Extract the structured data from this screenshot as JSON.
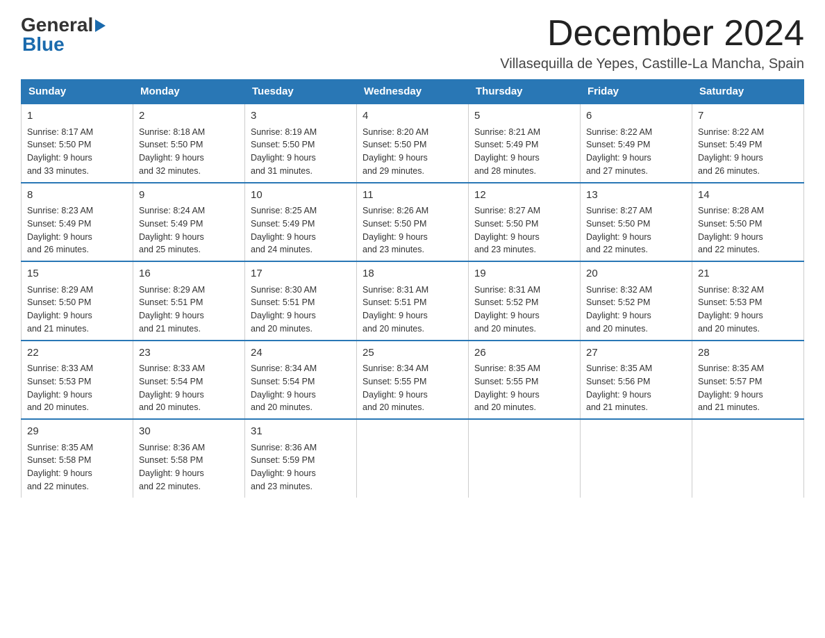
{
  "header": {
    "title": "December 2024",
    "subtitle": "Villasequilla de Yepes, Castille-La Mancha, Spain",
    "logo_general": "General",
    "logo_blue": "Blue"
  },
  "weekdays": [
    "Sunday",
    "Monday",
    "Tuesday",
    "Wednesday",
    "Thursday",
    "Friday",
    "Saturday"
  ],
  "weeks": [
    [
      {
        "day": "1",
        "sunrise": "8:17 AM",
        "sunset": "5:50 PM",
        "daylight": "9 hours and 33 minutes."
      },
      {
        "day": "2",
        "sunrise": "8:18 AM",
        "sunset": "5:50 PM",
        "daylight": "9 hours and 32 minutes."
      },
      {
        "day": "3",
        "sunrise": "8:19 AM",
        "sunset": "5:50 PM",
        "daylight": "9 hours and 31 minutes."
      },
      {
        "day": "4",
        "sunrise": "8:20 AM",
        "sunset": "5:50 PM",
        "daylight": "9 hours and 29 minutes."
      },
      {
        "day": "5",
        "sunrise": "8:21 AM",
        "sunset": "5:49 PM",
        "daylight": "9 hours and 28 minutes."
      },
      {
        "day": "6",
        "sunrise": "8:22 AM",
        "sunset": "5:49 PM",
        "daylight": "9 hours and 27 minutes."
      },
      {
        "day": "7",
        "sunrise": "8:22 AM",
        "sunset": "5:49 PM",
        "daylight": "9 hours and 26 minutes."
      }
    ],
    [
      {
        "day": "8",
        "sunrise": "8:23 AM",
        "sunset": "5:49 PM",
        "daylight": "9 hours and 26 minutes."
      },
      {
        "day": "9",
        "sunrise": "8:24 AM",
        "sunset": "5:49 PM",
        "daylight": "9 hours and 25 minutes."
      },
      {
        "day": "10",
        "sunrise": "8:25 AM",
        "sunset": "5:49 PM",
        "daylight": "9 hours and 24 minutes."
      },
      {
        "day": "11",
        "sunrise": "8:26 AM",
        "sunset": "5:50 PM",
        "daylight": "9 hours and 23 minutes."
      },
      {
        "day": "12",
        "sunrise": "8:27 AM",
        "sunset": "5:50 PM",
        "daylight": "9 hours and 23 minutes."
      },
      {
        "day": "13",
        "sunrise": "8:27 AM",
        "sunset": "5:50 PM",
        "daylight": "9 hours and 22 minutes."
      },
      {
        "day": "14",
        "sunrise": "8:28 AM",
        "sunset": "5:50 PM",
        "daylight": "9 hours and 22 minutes."
      }
    ],
    [
      {
        "day": "15",
        "sunrise": "8:29 AM",
        "sunset": "5:50 PM",
        "daylight": "9 hours and 21 minutes."
      },
      {
        "day": "16",
        "sunrise": "8:29 AM",
        "sunset": "5:51 PM",
        "daylight": "9 hours and 21 minutes."
      },
      {
        "day": "17",
        "sunrise": "8:30 AM",
        "sunset": "5:51 PM",
        "daylight": "9 hours and 20 minutes."
      },
      {
        "day": "18",
        "sunrise": "8:31 AM",
        "sunset": "5:51 PM",
        "daylight": "9 hours and 20 minutes."
      },
      {
        "day": "19",
        "sunrise": "8:31 AM",
        "sunset": "5:52 PM",
        "daylight": "9 hours and 20 minutes."
      },
      {
        "day": "20",
        "sunrise": "8:32 AM",
        "sunset": "5:52 PM",
        "daylight": "9 hours and 20 minutes."
      },
      {
        "day": "21",
        "sunrise": "8:32 AM",
        "sunset": "5:53 PM",
        "daylight": "9 hours and 20 minutes."
      }
    ],
    [
      {
        "day": "22",
        "sunrise": "8:33 AM",
        "sunset": "5:53 PM",
        "daylight": "9 hours and 20 minutes."
      },
      {
        "day": "23",
        "sunrise": "8:33 AM",
        "sunset": "5:54 PM",
        "daylight": "9 hours and 20 minutes."
      },
      {
        "day": "24",
        "sunrise": "8:34 AM",
        "sunset": "5:54 PM",
        "daylight": "9 hours and 20 minutes."
      },
      {
        "day": "25",
        "sunrise": "8:34 AM",
        "sunset": "5:55 PM",
        "daylight": "9 hours and 20 minutes."
      },
      {
        "day": "26",
        "sunrise": "8:35 AM",
        "sunset": "5:55 PM",
        "daylight": "9 hours and 20 minutes."
      },
      {
        "day": "27",
        "sunrise": "8:35 AM",
        "sunset": "5:56 PM",
        "daylight": "9 hours and 21 minutes."
      },
      {
        "day": "28",
        "sunrise": "8:35 AM",
        "sunset": "5:57 PM",
        "daylight": "9 hours and 21 minutes."
      }
    ],
    [
      {
        "day": "29",
        "sunrise": "8:35 AM",
        "sunset": "5:58 PM",
        "daylight": "9 hours and 22 minutes."
      },
      {
        "day": "30",
        "sunrise": "8:36 AM",
        "sunset": "5:58 PM",
        "daylight": "9 hours and 22 minutes."
      },
      {
        "day": "31",
        "sunrise": "8:36 AM",
        "sunset": "5:59 PM",
        "daylight": "9 hours and 23 minutes."
      },
      null,
      null,
      null,
      null
    ]
  ],
  "labels": {
    "sunrise": "Sunrise:",
    "sunset": "Sunset:",
    "daylight": "Daylight:"
  }
}
